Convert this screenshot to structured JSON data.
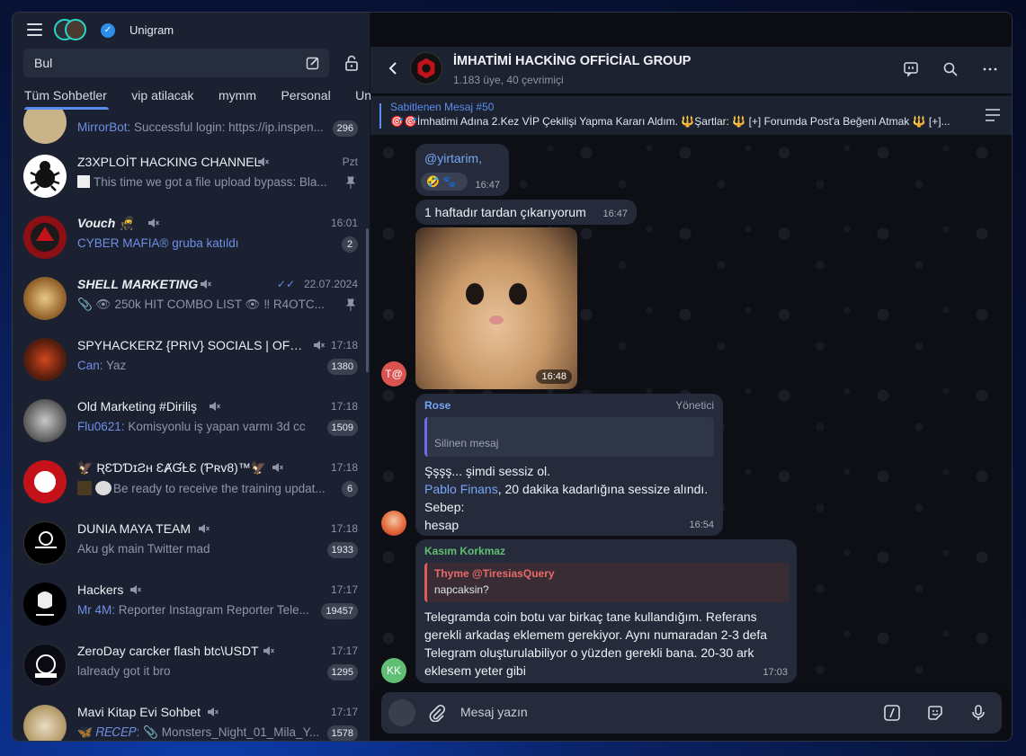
{
  "app": {
    "title": "Unigram"
  },
  "search": {
    "placeholder": "Bul"
  },
  "tabs": [
    {
      "label": "Tüm Sohbetler",
      "active": true
    },
    {
      "label": "vip atilacak"
    },
    {
      "label": "mymm"
    },
    {
      "label": "Personal"
    },
    {
      "label": "Unlim"
    }
  ],
  "chats": [
    {
      "name": "MirrorBot",
      "preview": "Successful login: https://ip.inspen...",
      "badge": "296",
      "partial": true
    },
    {
      "name": "Z3XPLOİT HACKING CHANNEL",
      "time": "Pzt",
      "preview": "This time we got a file upload bypass: Bla...",
      "pinned": true,
      "muted": true
    },
    {
      "name": "Vouch 🥷",
      "time": "16:01",
      "sender": "CYBER MAFIA® gruba katıldı",
      "preview": "",
      "badge": "2",
      "muted": true,
      "bold": true
    },
    {
      "name": "SHELL MARKETING",
      "time": "22.07.2024",
      "preview": "📎 👁 250k HIT COMBO LIST 👁  ‼ R4OTC...",
      "pinned": true,
      "muted": true,
      "bold": true,
      "read": true
    },
    {
      "name": "SPYHACKERZ {PRIV} SOCIALS | OFFICIA...",
      "time": "17:18",
      "sender": "Can:",
      "preview": "Yaz",
      "badge": "1380",
      "muted": true
    },
    {
      "name": "Old Marketing #Diriliş",
      "time": "17:18",
      "sender": "Flu0621:",
      "preview": "Komisyonlu iş yapan varmı 3d cc",
      "badge": "1509",
      "muted": true
    },
    {
      "name": "🦅 ƦƐƊƊɪƧʜ ƐȺƓȽƐ (Ƥʀᴠ8)™🦅",
      "time": "17:18",
      "preview": "Be ready to receive the training updat...",
      "badge": "6",
      "muted": true
    },
    {
      "name": "DUNIA MAYA TEAM",
      "time": "17:18",
      "preview": "Aku gk main Twitter mad",
      "badge": "1933",
      "muted": true
    },
    {
      "name": "Hackers",
      "time": "17:17",
      "sender": "Mr 4M:",
      "preview": "Reporter Instagram  Reporter Tele...",
      "badge": "19457",
      "muted": true
    },
    {
      "name": "ZeroDay carcker flash btc\\USDT",
      "time": "17:17",
      "preview": "lalready got it bro",
      "badge": "1295",
      "muted": true
    },
    {
      "name": "Mavi Kitap Evi Sohbet",
      "time": "17:17",
      "sender": "🦋 𝑅𝐸𝐶𝐸𝑃:",
      "preview": "📎 Monsters_Night_01_Mila_Y...",
      "badge": "1578",
      "muted": true
    }
  ],
  "group": {
    "title": "İMHATİMİ HACKİNG OFFİCİAL GROUP",
    "subtitle": "1.183 üye, 40 çevrimiçi"
  },
  "pinned": {
    "title": "Sabitlenen Mesaj #50",
    "text": "🎯🎯İmhatimi Adına 2.Kez VİP Çekilişi Yapma Kararı Aldım. 🔱Şartlar: 🔱 [+] Forumda Post'a Beğeni Atmak 🔱 [+]..."
  },
  "messages": {
    "m1": {
      "text": "@yirtarim,",
      "reactions": "🤣 🐾",
      "time": "16:47"
    },
    "m2": {
      "text": "1 haftadır tardan çıkarıyorum",
      "time": "16:47"
    },
    "m3": {
      "time": "16:48",
      "avatar": "T@"
    },
    "m4": {
      "sender": "Rose",
      "role": "Yönetici",
      "reply": "Silinen mesaj",
      "line1": "Şşşş... şimdi sessiz ol.",
      "mention": "Pablo Finans",
      "line2": ", 20 dakika kadarlığına sessize alındı.",
      "line3": "Sebep:",
      "line4": "hesap",
      "time": "16:54"
    },
    "m5": {
      "sender": "Kasım Korkmaz",
      "reply_name": "Thyme @TiresiasQuery",
      "reply_text": "napcaksin?",
      "text": "Telegramda coin botu var birkaç tane kullandığım. Referans gerekli arkadaş eklemem gerekiyor. Aynı numaradan 2-3 defa Telegram oluşturulabiliyor o yüzden gerekli bana. 20-30 ark eklesem yeter gibi",
      "time": "17:03",
      "avatar": "KK"
    }
  },
  "composer": {
    "placeholder": "Mesaj yazın"
  },
  "colors": {
    "accent": "#5b8def",
    "bubble": "#252b3a",
    "sidebar": "#1b2130"
  }
}
